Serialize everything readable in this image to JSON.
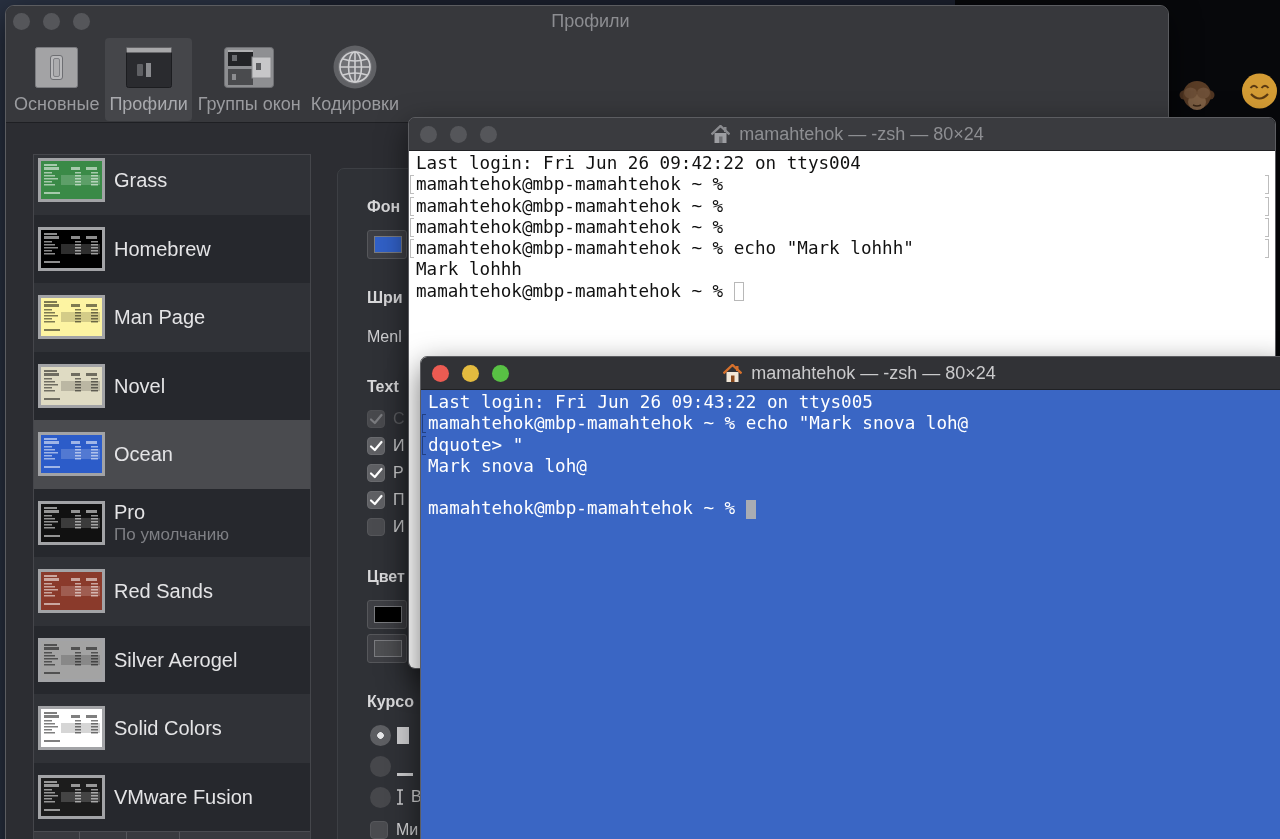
{
  "preferences_window": {
    "title": "Профили",
    "toolbar": [
      {
        "label": "Основные",
        "selected": false
      },
      {
        "label": "Профили",
        "selected": true
      },
      {
        "label": "Группы окон",
        "selected": false
      },
      {
        "label": "Кодировки",
        "selected": false
      }
    ],
    "profiles": [
      {
        "name": "Grass",
        "selected": false,
        "color": "#3a8a47"
      },
      {
        "name": "Homebrew",
        "selected": false,
        "color": "#000000"
      },
      {
        "name": "Man Page",
        "selected": false,
        "color": "#fdf4a2"
      },
      {
        "name": "Novel",
        "selected": false,
        "color": "#dfdbc3"
      },
      {
        "name": "Ocean",
        "selected": true,
        "color": "#2c5cc9"
      },
      {
        "name": "Pro",
        "subtitle": "По умолчанию",
        "selected": false,
        "color": "#111111"
      },
      {
        "name": "Red Sands",
        "selected": false,
        "color": "#8a3a2b"
      },
      {
        "name": "Silver Aerogel",
        "selected": false,
        "color": "#a3a3a3"
      },
      {
        "name": "Solid Colors",
        "selected": false,
        "color": "#ffffff"
      },
      {
        "name": "VMware Fusion",
        "selected": false,
        "color": "#1c1c1c"
      }
    ],
    "settings": [
      {
        "kind": "heading",
        "text": "Фон"
      },
      {
        "kind": "swatch",
        "color": "#3160c6"
      },
      {
        "kind": "heading",
        "text": "Шри"
      },
      {
        "kind": "value",
        "text": "Menl"
      },
      {
        "kind": "heading",
        "text": "Text"
      },
      {
        "kind": "checkbox",
        "label": "С",
        "checked": true,
        "disabled": true
      },
      {
        "kind": "checkbox",
        "label": "И",
        "checked": true,
        "disabled": false
      },
      {
        "kind": "checkbox",
        "label": "Р",
        "checked": true,
        "disabled": false
      },
      {
        "kind": "checkbox",
        "label": "П",
        "checked": true,
        "disabled": false
      },
      {
        "kind": "checkbox",
        "label": "И",
        "checked": false,
        "disabled": false
      },
      {
        "kind": "heading",
        "text": "Цвет"
      },
      {
        "kind": "swatch",
        "color": "#000000"
      },
      {
        "kind": "swatch",
        "color": "#4e4f52"
      },
      {
        "kind": "heading",
        "text": "Курсо"
      },
      {
        "kind": "block",
        "selected": true
      },
      {
        "kind": "underline",
        "selected": false
      },
      {
        "kind": "bar",
        "label": "В",
        "selected": false
      },
      {
        "kind": "checkbox",
        "label": "Ми",
        "checked": false,
        "disabled": false
      }
    ]
  },
  "terminal_windows": [
    {
      "title": "mamahtehok — -zsh — 80×24",
      "focused": false,
      "color": "#ffffff",
      "lines": [
        {
          "text": "Last login: Fri Jun 26 09:42:22 on ttys004",
          "mark_left": false,
          "mark_right": false
        },
        {
          "text": "mamahtehok@mbp-mamahtehok ~ %",
          "mark_left": true,
          "mark_right": true
        },
        {
          "text": "mamahtehok@mbp-mamahtehok ~ %",
          "mark_left": true,
          "mark_right": true
        },
        {
          "text": "mamahtehok@mbp-mamahtehok ~ %",
          "mark_left": true,
          "mark_right": true
        },
        {
          "text": "mamahtehok@mbp-mamahtehok ~ % echo \"Mark lohhh\"",
          "mark_left": true,
          "mark_right": true
        },
        {
          "text": "Mark lohhh",
          "mark_left": false,
          "mark_right": false
        },
        {
          "text": "mamahtehok@mbp-mamahtehok ~ %",
          "mark_left": false,
          "mark_right": false
        }
      ]
    },
    {
      "title": "mamahtehok — -zsh — 80×24",
      "focused": true,
      "color": "#3a66c4",
      "lines": [
        {
          "text": "Last login: Fri Jun 26 09:43:22 on ttys005",
          "mark_left": false,
          "mark_right": false
        },
        {
          "text": "mamahtehok@mbp-mamahtehok ~ % echo \"Mark snova loh@",
          "mark_left": true,
          "mark_right": false
        },
        {
          "text": "dquote> \"",
          "mark_left": true,
          "mark_right": false
        },
        {
          "text": "Mark snova loh@",
          "mark_left": false,
          "mark_right": false
        },
        {
          "mark_left": false,
          "mark_right": false
        },
        {
          "text": "mamahtehok@mbp-mamahtehok ~ %",
          "mark_left": false,
          "mark_right": false
        }
      ]
    }
  ]
}
